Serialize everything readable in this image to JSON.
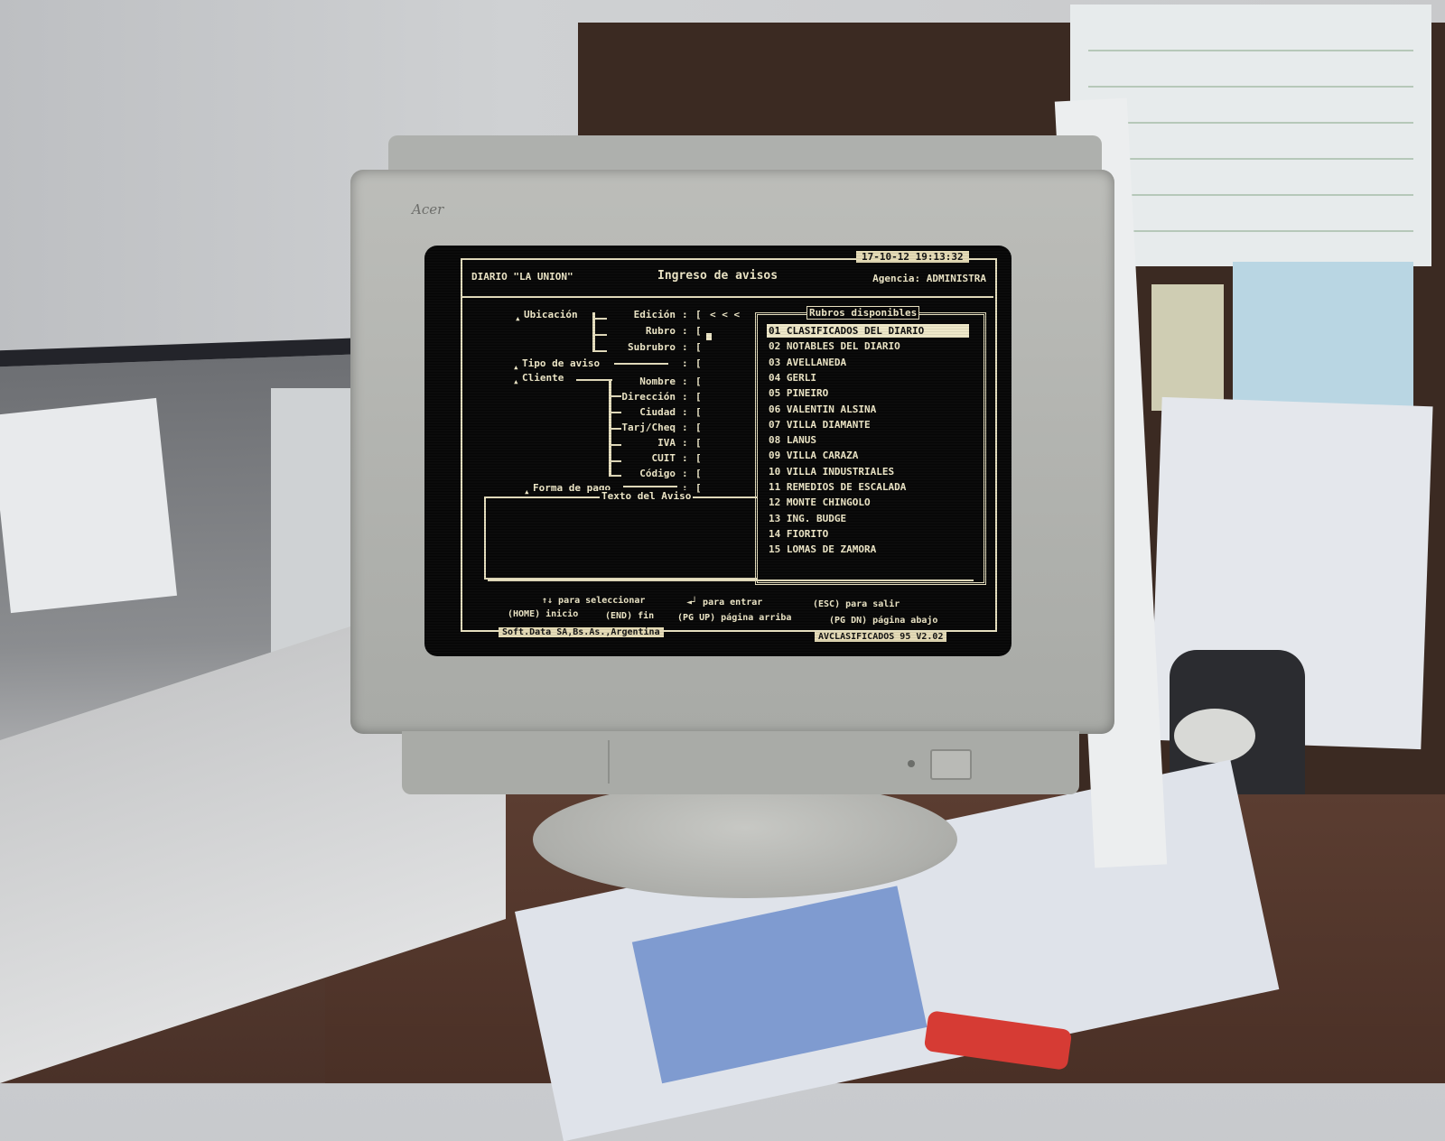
{
  "screen": {
    "header": {
      "left": "DIARIO \"LA UNION\"",
      "title": "Ingreso de avisos",
      "right": "Agencia: ADMINISTRA",
      "datetime": "17-10-12  19:13:32"
    },
    "fields": {
      "ubicacion": "Ubicación",
      "edicion": "Edición",
      "rubro": "Rubro",
      "subrubro": "Subrubro",
      "tipo_aviso": "Tipo de aviso",
      "cliente": "Cliente",
      "nombre": "Nombre",
      "direccion": "Dirección",
      "ciudad": "Ciudad",
      "tarj_cheq": "Tarj/Cheq",
      "iva": "IVA",
      "cuit": "CUIT",
      "codigo": "Código",
      "forma_pago": "Forma de pago",
      "edicion_arrows": "< < <"
    },
    "rubros_panel": {
      "title": "Rubros disponibles",
      "items": [
        "01 CLASIFICADOS DEL DIARIO",
        "02 NOTABLES DEL DIARIO",
        "03 AVELLANEDA",
        "04 GERLI",
        "05 PINEIRO",
        "06 VALENTIN ALSINA",
        "07 VILLA DIAMANTE",
        "08 LANUS",
        "09 VILLA CARAZA",
        "10 VILLA INDUSTRIALES",
        "11 REMEDIOS DE ESCALADA",
        "12 MONTE CHINGOLO",
        "13 ING. BUDGE",
        "14 FIORITO",
        "15 LOMAS DE ZAMORA"
      ],
      "selected_index": 0
    },
    "texto_aviso": {
      "title": "Texto del Aviso"
    },
    "help": {
      "line1_a": "↑↓ para seleccionar",
      "line1_b": "◄┘ para entrar",
      "line1_c": "(ESC) para salir",
      "line2_a": "(HOME) inicio",
      "line2_b": "(END) fin",
      "line2_c": "(PG UP) página arriba",
      "line2_d": "(PG DN) página abajo"
    },
    "status": {
      "left": "Soft.Data SA,Bs.As.,Argentina",
      "right": "AVCLASIFICADOS 95 V2.02"
    }
  },
  "monitor": {
    "brand": "Acer"
  },
  "colors": {
    "phosphor": "#efe8c8",
    "screen_bg": "#060606",
    "bezel": "#bcbdb9"
  }
}
